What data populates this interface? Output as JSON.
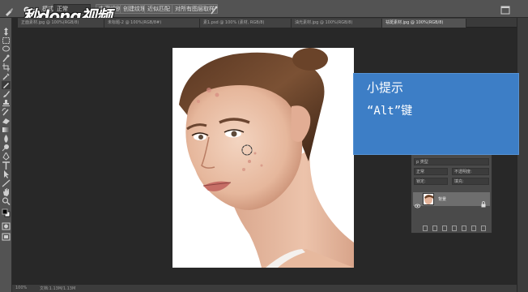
{
  "logo": {
    "text": "秒dong视频"
  },
  "options_bar": {
    "mode_label": "模式:",
    "mode_value": "正常",
    "opacity_label": "不透明度:",
    "opacity_value": "100%",
    "content_aware": "内容识别",
    "create_texture": "创建纹理",
    "proximity_match": "近似匹配",
    "sample_all_layers": "对所有图层取样"
  },
  "tabs": [
    {
      "label": "正面素材.jpg @ 100%(RGB/8)",
      "active": false
    },
    {
      "label": "未标题-2 @ 100%(RGB/8#)",
      "active": false
    },
    {
      "label": "素1.psd @ 100% (素材, RGB/8)",
      "active": false
    },
    {
      "label": "油光素材.jpg @ 100%(RGB/8)",
      "active": false
    },
    {
      "label": "祛斑素材.jpg @ 100%(RGB/8)",
      "active": true
    }
  ],
  "tip": {
    "title": "小提示",
    "body": "“Alt”键"
  },
  "layers_panel": {
    "tabs": [
      "图层",
      "通道",
      "路径"
    ],
    "filter_label": "p 类型",
    "blend_mode": "正常",
    "opacity_label": "不透明度:",
    "lock_label": "锁定:",
    "fill_label": "填充:",
    "layer_name": "背景"
  },
  "status": {
    "zoom": "100%",
    "doc_info": "文档:1.13M/1.13M"
  },
  "colors": {
    "tip_background": "#3d7ec6",
    "workspace": "#282828",
    "panel": "#535353"
  }
}
